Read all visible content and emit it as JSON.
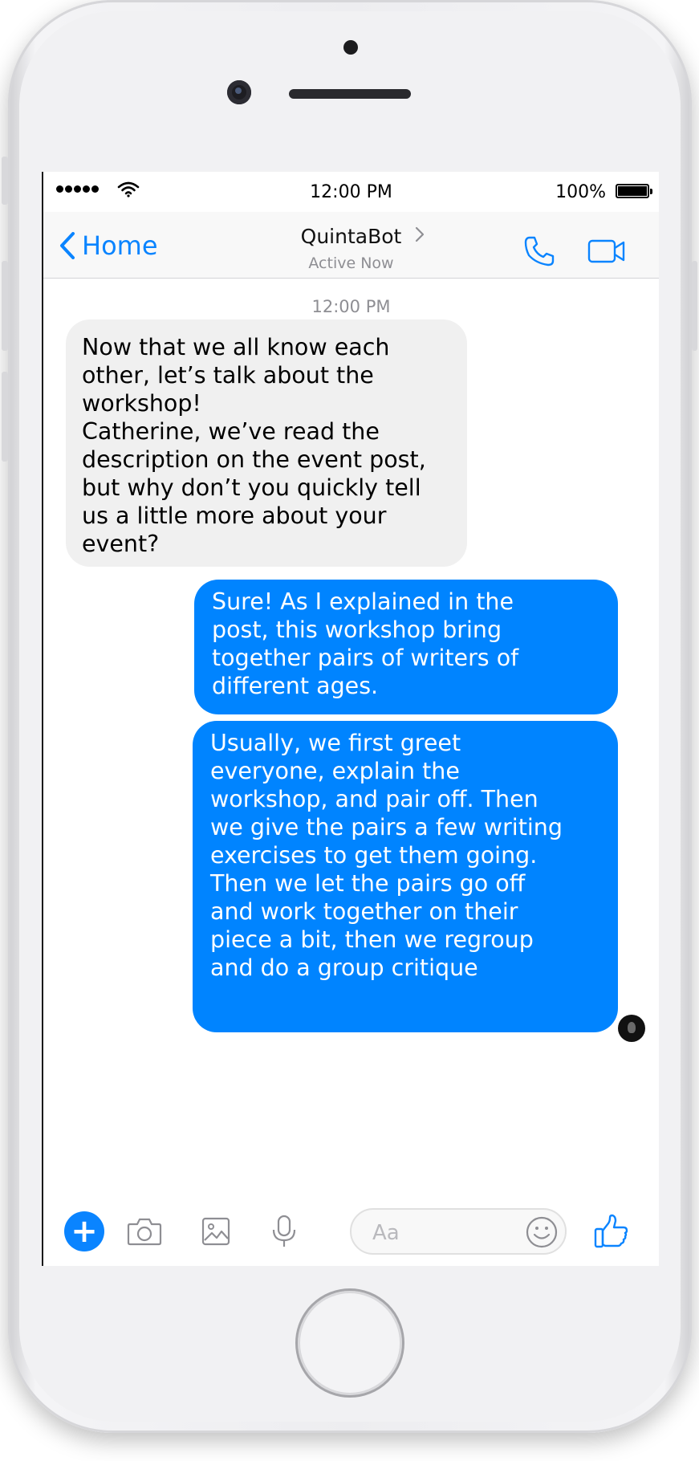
{
  "status_bar": {
    "time": "12:00 PM",
    "battery_percent": "100%",
    "signal_dots": 5,
    "battery_level": 1.0
  },
  "nav": {
    "back_label": "Home",
    "contact_name": "QuintaBot",
    "contact_status": "Active Now"
  },
  "chat": {
    "timestamp": "12:00 PM",
    "messages": [
      {
        "sender": "bot",
        "text": "Now that we all know each\nother, let’s talk about the\nworkshop!\nCatherine, we’ve read the\ndescription on the event post,\nbut why don’t you quickly tell\nus a little more about your\nevent?"
      },
      {
        "sender": "user",
        "text": "Sure! As I explained in the\npost, this workshop bring\ntogether pairs of writers of\ndifferent ages."
      },
      {
        "sender": "user",
        "text": "Usually, we first greet\neveryone, explain the\nworkshop, and pair off. Then\nwe give the pairs a few writing\nexercises to get them going.\nThen we let the pairs go off\nand work together on their\npiece a bit, then we regroup\nand do a group critique"
      }
    ]
  },
  "composer": {
    "placeholder": "Aa",
    "icons": [
      "plus-icon",
      "camera-icon",
      "image-icon",
      "microphone-icon",
      "smiley-icon",
      "thumbs-up-icon"
    ]
  },
  "colors": {
    "accent": "#0a84ff",
    "outgoing_bubble": "#0084ff",
    "incoming_bubble": "#f0f0f0",
    "secondary_text": "#8e8e93"
  }
}
